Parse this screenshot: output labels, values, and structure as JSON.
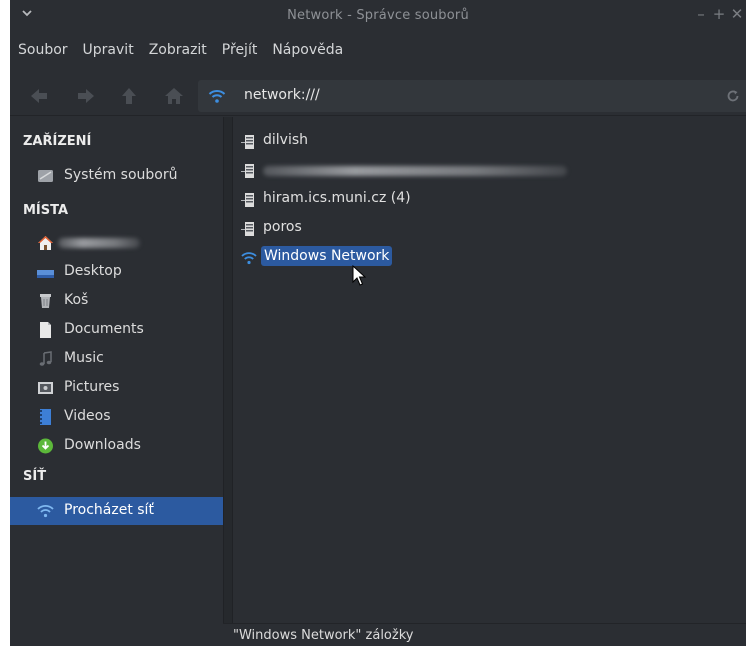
{
  "window": {
    "title": "Network - Správce souborů",
    "buttons": {
      "minimize": "–",
      "maximize": "+",
      "close": "✕"
    }
  },
  "menubar": {
    "items": [
      "Soubor",
      "Upravit",
      "Zobrazit",
      "Přejít",
      "Nápověda"
    ]
  },
  "toolbar": {
    "back_icon": "arrow-left-icon",
    "forward_icon": "arrow-right-icon",
    "up_icon": "arrow-up-icon",
    "home_icon": "home-icon",
    "address": "network:///",
    "reload_icon": "reload-icon"
  },
  "sidebar": {
    "devices_header": "ZAŘÍZENÍ",
    "devices": [
      {
        "label": "Systém souborů",
        "icon": "drive-icon"
      }
    ],
    "places_header": "MÍSTA",
    "places": [
      {
        "label": "",
        "icon": "home-icon"
      },
      {
        "label": "Desktop",
        "icon": "desktop-icon"
      },
      {
        "label": "Koš",
        "icon": "trash-icon"
      },
      {
        "label": "Documents",
        "icon": "document-icon"
      },
      {
        "label": "Music",
        "icon": "music-icon"
      },
      {
        "label": "Pictures",
        "icon": "pictures-icon"
      },
      {
        "label": "Videos",
        "icon": "videos-icon"
      },
      {
        "label": "Downloads",
        "icon": "downloads-icon"
      }
    ],
    "network_header": "SÍŤ",
    "network": [
      {
        "label": "Procházet síť",
        "icon": "network-icon",
        "selected": true
      }
    ]
  },
  "main": {
    "items": [
      {
        "label": "dilvish",
        "icon": "server-icon"
      },
      {
        "label": "",
        "icon": "server-icon"
      },
      {
        "label": "hiram.ics.muni.cz (4)",
        "icon": "server-icon"
      },
      {
        "label": "poros",
        "icon": "server-icon"
      },
      {
        "label": "Windows Network",
        "icon": "network-icon",
        "selected": true
      }
    ]
  },
  "statusbar": {
    "text": "\"Windows Network\" záložky"
  },
  "colors": {
    "background": "#2b2e33",
    "selection": "#2c5aa0",
    "network_icon": "#3d8ee0"
  }
}
